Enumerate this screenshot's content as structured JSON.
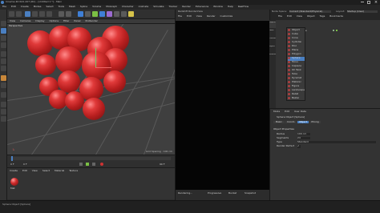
{
  "window": {
    "title": "Cinema 4D R21.207 (RC) - [Untitled 1 *] - Main"
  },
  "menu": [
    "File",
    "Edit",
    "Create",
    "Modes",
    "Select",
    "Tools",
    "Mesh",
    "Spline",
    "Volume",
    "MoGraph",
    "Character",
    "Animate",
    "Simulate",
    "Tracker",
    "Render",
    "Extensions",
    "Window",
    "Help",
    "RealFlow"
  ],
  "top_right": {
    "node_space_label": "Node Space:",
    "node_space_value": "Current (Standard/Physical)",
    "layout_label": "Layout:",
    "layout_value": "Startup (User)"
  },
  "viewport": {
    "menus": [
      "View",
      "Cameras",
      "Display",
      "Options",
      "Filter",
      "Panel",
      "ProRender"
    ],
    "name": "Perspective",
    "grid_spacing": "Grid Spacing : 100 cm"
  },
  "timeline": {
    "start": "0 F",
    "end": "90 F",
    "current": "0 F"
  },
  "material_manager": {
    "menus": [
      "Create",
      "Edit",
      "View",
      "Select",
      "Material",
      "Texture"
    ],
    "material_name": "Mat"
  },
  "render_view": {
    "title": "Redshift RenderView",
    "menus": [
      "File",
      "Edit",
      "View",
      "Render",
      "Customize"
    ],
    "status": "Rendering...",
    "footer": [
      "Progressive",
      "Bucket",
      "Snapshot"
    ]
  },
  "objects_manager": {
    "menus": [
      "File",
      "Edit",
      "View",
      "Object",
      "Tags",
      "Bookmarks"
    ],
    "tabs": [
      "Objects",
      "Takes",
      "Content Browser",
      "Layers",
      "Structure"
    ],
    "objects": [
      {
        "name": "Sphere"
      }
    ],
    "create_menu": [
      "Object",
      "Cube",
      "Cone",
      "Cylinder",
      "Disc",
      "Plane",
      "Polygon",
      "Sphere",
      "Torus",
      "Capsule",
      "Oil Tank",
      "Tube",
      "Pyramid",
      "Platonic",
      "Figure",
      "Landscape",
      "Relief",
      "Bezier",
      "Spline"
    ]
  },
  "attributes": {
    "menus": [
      "Mode",
      "Edit",
      "User Data"
    ],
    "object_title": "Sphere Object [Sphere]",
    "tabs": [
      "Basic",
      "Coord.",
      "Object",
      "Phong"
    ],
    "section": "Object Properties",
    "rows": [
      {
        "label": "Radius",
        "value": "100 cm"
      },
      {
        "label": "Segments",
        "value": "24"
      },
      {
        "label": "Type",
        "value": "Standard"
      },
      {
        "label": "Render Perfect",
        "value": "✓"
      }
    ]
  },
  "statusbar": {
    "text": "Sphere Object [Sphere]"
  },
  "colors": {
    "accent": "#4a7fc1",
    "sphere": "#c82424",
    "render_bg": "#050505"
  }
}
